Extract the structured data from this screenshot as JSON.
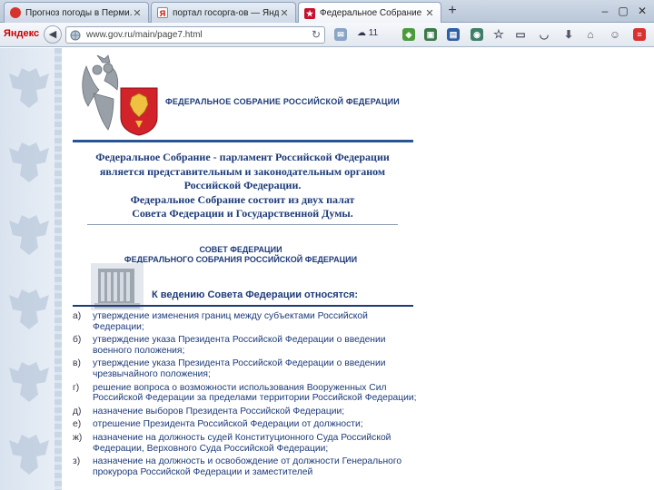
{
  "tabs": [
    {
      "title": "Прогноз погоды в Перми...",
      "icon": "weather-icon",
      "color": "#d8322e"
    },
    {
      "title": "портал госорга-ов — Янд...",
      "icon": "yandex-icon",
      "color": "#ffffff"
    },
    {
      "title": "Федеральное Собрание Р...",
      "icon": "coat-of-arms-icon",
      "color": "#c8102e"
    }
  ],
  "nav": {
    "brand": "Яндекс",
    "url": "www.gov.ru/main/page7.html",
    "weather": "11"
  },
  "page": {
    "org_title": "ФЕДЕРАЛЬНОЕ СОБРАНИЕ РОССИЙСКОЙ ФЕДЕРАЦИИ",
    "intro": [
      "Федеральное Собрание - парламент Российской Федерации",
      "является представительным и законодательным органом",
      "Российской Федерации.",
      "Федеральное Собрание состоит из двух палат",
      "Совета Федерации и Государственной Думы."
    ],
    "sf_title": [
      "СОВЕТ ФЕДЕРАЦИИ",
      "ФЕДЕРАЛЬНОГО СОБРАНИЯ РОССИЙСКОЙ ФЕДЕРАЦИИ"
    ],
    "competence_heading": "К ведению Совета Федерации относятся:",
    "items": [
      {
        "letter": "а)",
        "text": "утверждение изменения границ между субъектами Российской Федерации;"
      },
      {
        "letter": "б)",
        "text": "утверждение указа Президента Российской Федерации о введении военного положения;"
      },
      {
        "letter": "в)",
        "text": "утверждение указа Президента Российской Федерации о введении чрезвычайного положения;"
      },
      {
        "letter": "г)",
        "text": "решение вопроса о возможности использования Вооруженных Сил Российской Федерации за пределами территории Российской Федерации;"
      },
      {
        "letter": "д)",
        "text": "назначение выборов Президента Российской Федерации;"
      },
      {
        "letter": "е)",
        "text": "отрешение Президента Российской Федерации от должности;"
      },
      {
        "letter": "ж)",
        "text": "назначение на должность судей Конституционного Суда Российской Федерации, Верховного Суда Российской Федерации;"
      },
      {
        "letter": "з)",
        "text": "назначение на должность и освобождение от должности Генерального прокурора Российской Федерации и заместителей"
      }
    ]
  }
}
